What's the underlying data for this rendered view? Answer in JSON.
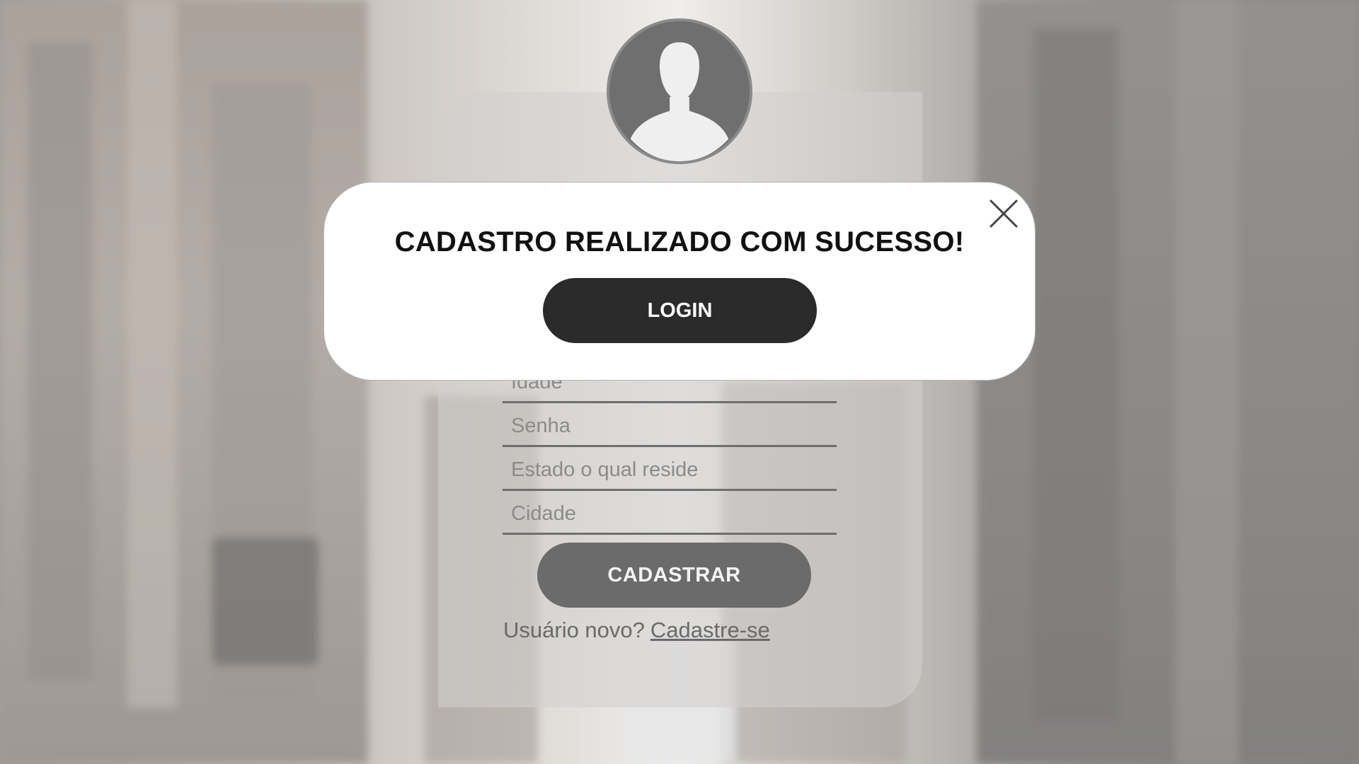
{
  "modal": {
    "title": "CADASTRO REALIZADO COM SUCESSO!",
    "login_label": "LOGIN"
  },
  "form": {
    "fields": [
      {
        "placeholder": "Idade"
      },
      {
        "placeholder": "Senha"
      },
      {
        "placeholder": "Estado o qual reside"
      },
      {
        "placeholder": "Cidade"
      }
    ],
    "submit_label": "CADASTRAR",
    "new_user_text": "Usuário novo?",
    "signup_link": "Cadastre-se"
  },
  "icons": {
    "avatar": "user-silhouette-icon",
    "close": "close-icon"
  },
  "colors": {
    "modal_bg": "#ffffff",
    "login_button": "#2b2b2b",
    "cadastrar_button": "#6b6b6b"
  }
}
